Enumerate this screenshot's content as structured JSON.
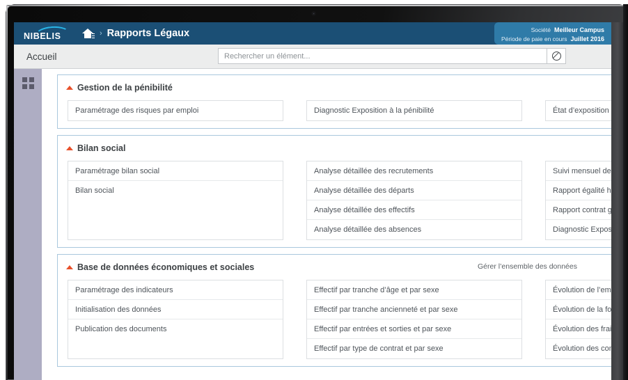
{
  "device": {
    "camera": "camera-dot"
  },
  "topbar": {
    "logo_text": "NIBELIS",
    "home_icon": "home-icon",
    "separator": "›",
    "title": "Rapports Légaux",
    "company_label": "Société",
    "company_value": "Meilleur Campus",
    "period_label": "Période de paie en cours",
    "period_value": "Juillet 2016",
    "accent_blue": "#1b4f75",
    "accent_light_blue": "#2f7ba8",
    "logo_arc_color": "#29b6e8"
  },
  "subbar": {
    "breadcrumb": "Accueil",
    "search_placeholder": "Rechercher un élément...",
    "search_value": "",
    "clear_icon": "no-entry-icon"
  },
  "leftrail": {
    "grid_icon": "grid-apps-icon",
    "color": "#aeadc3"
  },
  "caret_color": "#e8502a",
  "sections": [
    {
      "id": "gestion-penibilite",
      "title": "Gestion de la pénibilité",
      "caret": "chevron-up-icon",
      "link": "",
      "columns": [
        {
          "items": [
            "Paramétrage des risques par emploi"
          ]
        },
        {
          "items": [
            "Diagnostic Exposition à la pénibilité"
          ]
        },
        {
          "items": [
            "État d’exposition aux facteurs"
          ]
        }
      ]
    },
    {
      "id": "bilan-social",
      "title": "Bilan social",
      "caret": "chevron-up-icon",
      "link": "",
      "columns": [
        {
          "items": [
            "Paramétrage bilan social",
            "Bilan social"
          ]
        },
        {
          "items": [
            "Analyse détaillée des recrutements",
            "Analyse détaillée des départs",
            "Analyse détaillée des effectifs",
            "Analyse détaillée des absences"
          ]
        },
        {
          "items": [
            "Suivi mensuel des effectifs",
            "Rapport égalité hommes femmes",
            "Rapport contrat générationnel",
            "Diagnostic Exposition à la pénibilité"
          ]
        }
      ]
    },
    {
      "id": "base-donnees",
      "title": "Base de données économiques et sociales",
      "caret": "chevron-up-icon",
      "link": "Gérer l’ensemble des données",
      "columns": [
        {
          "items": [
            "Paramétrage des indicateurs",
            "Initialisation des données",
            "Publication des documents"
          ]
        },
        {
          "items": [
            "Effectif par tranche d’âge et par sexe",
            "Effectif par tranche ancienneté et par sexe",
            "Effectif par entrées et sorties et par sexe",
            "Effectif par type de contrat et par sexe"
          ]
        },
        {
          "items": [
            "Évolution de l’emploi des salariés",
            "Évolution de la formation",
            "Évolution des frais de personnel",
            "Évolution des conditions de travail"
          ]
        }
      ]
    }
  ]
}
